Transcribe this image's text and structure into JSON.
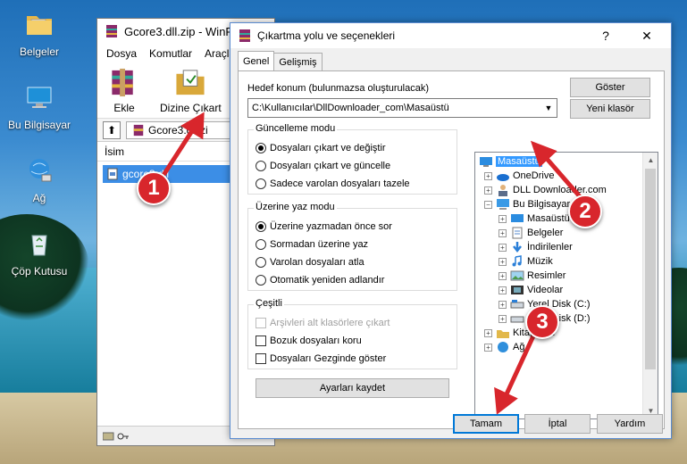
{
  "desktop": {
    "icons": [
      {
        "label": "Belgeler",
        "icon": "folder-documents-icon"
      },
      {
        "label": "Bu Bilgisayar",
        "icon": "computer-icon"
      },
      {
        "label": "Ağ",
        "icon": "network-icon"
      },
      {
        "label": "Çöp Kutusu",
        "icon": "recycle-bin-icon"
      }
    ]
  },
  "winrar": {
    "title": "Gcore3.dll.zip - WinR",
    "menu": [
      "Dosya",
      "Komutlar",
      "Araçla"
    ],
    "toolbar": {
      "add_label": "Ekle",
      "extract_label": "Dizine Çıkart"
    },
    "path": "Gcore3.dll.zi",
    "column_name": "İsim",
    "file_name": "gcore3.dll"
  },
  "dialog": {
    "title": "Çıkartma yolu ve seçenekleri",
    "help": "?",
    "close": "✕",
    "tabs": [
      "Genel",
      "Gelişmiş"
    ],
    "dest_label": "Hedef konum (bulunmazsa oluşturulacak)",
    "dest_value": "C:\\Kullanıcılar\\DllDownloader_com\\Masaüstü",
    "show_button": "Göster",
    "new_folder_button": "Yeni klasör",
    "update_group": {
      "title": "Güncelleme modu",
      "options": [
        "Dosyaları çıkart ve değiştir",
        "Dosyaları çıkart ve güncelle",
        "Sadece varolan dosyaları tazele"
      ],
      "selected": 0
    },
    "overwrite_group": {
      "title": "Üzerine yaz modu",
      "options": [
        "Üzerine yazmadan önce sor",
        "Sormadan üzerine yaz",
        "Varolan dosyaları atla",
        "Otomatik yeniden adlandır"
      ],
      "selected": 0
    },
    "misc_group": {
      "title": "Çeşitli",
      "options": [
        "Arşivleri alt klasörlere çıkart",
        "Bozuk dosyaları koru",
        "Dosyaları Gezginde göster"
      ]
    },
    "save_settings_button": "Ayarları kaydet",
    "ok_button": "Tamam",
    "cancel_button": "İptal",
    "help_button": "Yardım",
    "tree": [
      {
        "label": "Masaüstü",
        "icon": "desktop-icon",
        "selected": true
      },
      {
        "label": "OneDrive",
        "icon": "onedrive-icon"
      },
      {
        "label": "DLL Downloader.com",
        "icon": "user-icon"
      },
      {
        "label": "Bu Bilgisayar",
        "icon": "computer-icon"
      },
      {
        "label": "Masaüstü",
        "icon": "desktop-icon"
      },
      {
        "label": "Belgeler",
        "icon": "documents-icon"
      },
      {
        "label": "İndirilenler",
        "icon": "downloads-icon"
      },
      {
        "label": "Müzik",
        "icon": "music-icon"
      },
      {
        "label": "Resimler",
        "icon": "pictures-icon"
      },
      {
        "label": "Videolar",
        "icon": "videos-icon"
      },
      {
        "label": "Yerel Disk (C:)",
        "icon": "drive-icon"
      },
      {
        "label": "Yerel Disk (D:)",
        "icon": "drive-icon"
      },
      {
        "label": "Kitaplıklar",
        "icon": "libraries-icon"
      },
      {
        "label": "Ağ",
        "icon": "network-icon"
      }
    ]
  },
  "annotations": {
    "step1": "1",
    "step2": "2",
    "step3": "3",
    "color": "#d8262c"
  }
}
